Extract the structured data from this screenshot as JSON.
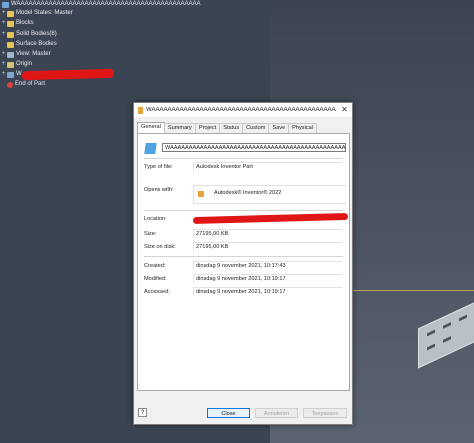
{
  "browser": {
    "root_title": "WAAAAAAAAAAAAAAAAAAAAAAAAAAAAAAAAAAAAAAAAAAAAAA",
    "items": [
      {
        "label": "Model States: Master",
        "icon": "model-states-icon"
      },
      {
        "label": "Blocks",
        "icon": "folder-icon"
      },
      {
        "label": "Solid Bodies(8)",
        "icon": "folder-icon"
      },
      {
        "label": "Surface Bodies",
        "icon": "folder-icon"
      },
      {
        "label": "View: Master",
        "icon": "view-icon"
      },
      {
        "label": "Origin",
        "icon": "folder-icon"
      },
      {
        "label": "W",
        "icon": "part-icon"
      },
      {
        "label": "End of Part",
        "icon": "end-of-part-icon"
      }
    ]
  },
  "dialog": {
    "title": "WAAAAAAAAAAAAAAAAAAAAAAAAAAAAAAAAAAAAAAAAAAAAAAAAAAAAAA",
    "close_glyph": "✕",
    "tabs": [
      "General",
      "Summary",
      "Project",
      "Status",
      "Custom",
      "Save",
      "Physical"
    ],
    "active_tab": "General",
    "general": {
      "file_name": "WAAAAAAAAAAAAAAAAAAAAAAAAAAAAAAAAAAAAAAAAAAAAAAAAAAAAA",
      "type_label": "Type of file:",
      "type_value": "Autodesk Inventor Part",
      "opens_label": "Opens with:",
      "opens_value": "Autodesk® Inventor® 2022",
      "location_label": "Location:",
      "size_label": "Size:",
      "size_value": "27195,00 KB",
      "size_disk_label": "Size on disk:",
      "size_disk_value": "27195,00 KB",
      "created_label": "Created:",
      "created_value": "dinsdag 9 november 2021, 10:17:43",
      "modified_label": "Modified:",
      "modified_value": "dinsdag 9 november 2021, 10:19:17",
      "accessed_label": "Accessed:",
      "accessed_value": "dinsdag 9 november 2021, 10:19:17"
    },
    "buttons": {
      "help": "?",
      "close": "Close",
      "cancel": "Annuleren",
      "apply": "Toepassen"
    }
  },
  "colors": {
    "browser_bg": "#3b4452",
    "redaction": "#e01515",
    "primary_button_border": "#0078d7"
  }
}
